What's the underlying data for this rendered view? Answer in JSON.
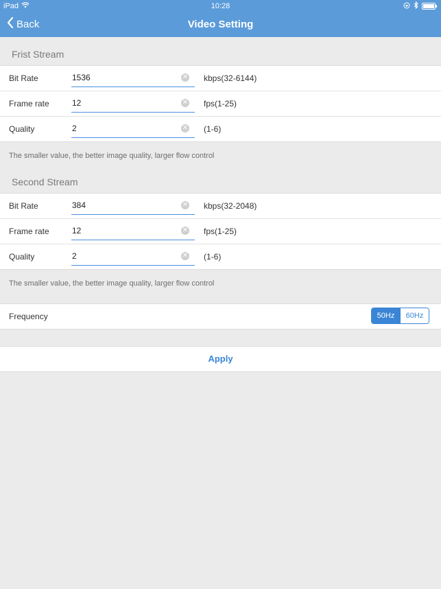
{
  "status_bar": {
    "device": "iPad",
    "time": "10:28"
  },
  "nav": {
    "back_label": "Back",
    "title": "Video Setting"
  },
  "first_stream": {
    "title": "Frist Stream",
    "rows": [
      {
        "label": "Bit Rate",
        "value": "1536",
        "range": "kbps(32-6144)"
      },
      {
        "label": "Frame rate",
        "value": "12",
        "range": "fps(1-25)"
      },
      {
        "label": "Quality",
        "value": "2",
        "range": "(1-6)"
      }
    ],
    "note": "The smaller value, the better image quality, larger flow control"
  },
  "second_stream": {
    "title": "Second Stream",
    "rows": [
      {
        "label": "Bit Rate",
        "value": "384",
        "range": "kbps(32-2048)"
      },
      {
        "label": "Frame rate",
        "value": "12",
        "range": "fps(1-25)"
      },
      {
        "label": "Quality",
        "value": "2",
        "range": "(1-6)"
      }
    ],
    "note": "The smaller value, the better image quality, larger flow control"
  },
  "frequency": {
    "label": "Frequency",
    "options": [
      "50Hz",
      "60Hz"
    ],
    "selected": "50Hz"
  },
  "apply_label": "Apply",
  "colors": {
    "nav_bar": "#5b9bd9",
    "accent": "#3a85d6",
    "background": "#ebebeb"
  }
}
